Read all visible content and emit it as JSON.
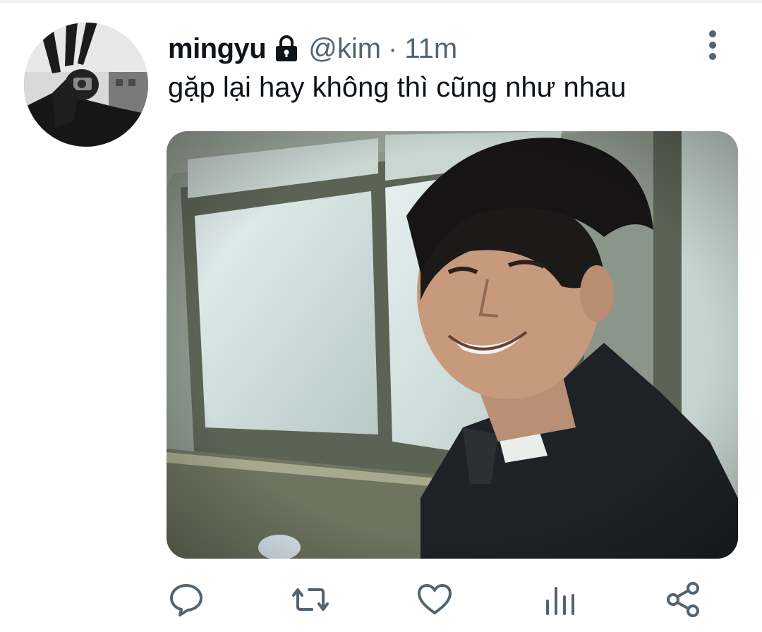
{
  "tweet": {
    "display_name": "mingyu",
    "handle": "@kim",
    "separator": "·",
    "time": "11m",
    "text": "gặp lại hay không thì cũng như nhau",
    "protected_icon": "lock-icon",
    "more_icon": "vertical-ellipsis-icon"
  },
  "avatar": {
    "icon": "profile-photo"
  },
  "media": {
    "icon": "photo-smiling-man-by-window"
  },
  "actions": [
    {
      "name": "reply",
      "icon": "speech-bubble-icon"
    },
    {
      "name": "retweet",
      "icon": "retweet-arrows-icon"
    },
    {
      "name": "like",
      "icon": "heart-icon"
    },
    {
      "name": "analytics",
      "icon": "bar-chart-icon"
    },
    {
      "name": "share",
      "icon": "share-nodes-icon"
    }
  ],
  "colors": {
    "text_primary": "#0f1419",
    "text_secondary": "#536471",
    "icon_gray": "#536471"
  }
}
